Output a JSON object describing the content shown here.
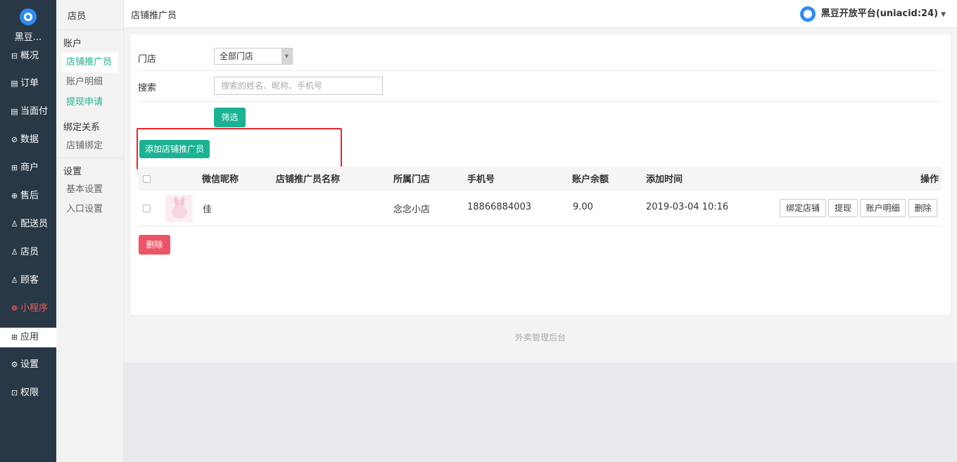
{
  "nav": {
    "brand": "黑豆...",
    "items": [
      {
        "label": "概况",
        "icon": "⊟"
      },
      {
        "label": "订单",
        "icon": "▤"
      },
      {
        "label": "当面付",
        "icon": "▤"
      },
      {
        "label": "数据",
        "icon": "⊘"
      },
      {
        "label": "商户",
        "icon": "⊞"
      },
      {
        "label": "售后",
        "icon": "⊕"
      },
      {
        "label": "配送员",
        "icon": "♙"
      },
      {
        "label": "店员",
        "icon": "♙"
      },
      {
        "label": "顾客",
        "icon": "♙"
      },
      {
        "label": "小程序",
        "icon": "❁"
      },
      {
        "label": "应用",
        "icon": "⊞"
      },
      {
        "label": "设置",
        "icon": "⚙"
      },
      {
        "label": "权限",
        "icon": "⊡"
      }
    ]
  },
  "subnav": {
    "title": "店员",
    "group_account": "账户",
    "link_promoter": "店铺推广员",
    "link_account_detail": "账户明细",
    "link_withdraw": "提现申请",
    "group_binding": "绑定关系",
    "link_store_binding": "店铺绑定",
    "group_settings": "设置",
    "link_basic_settings": "基本设置",
    "link_entry_settings": "入口设置"
  },
  "header": {
    "page_title": "店铺推广员",
    "account": "黑豆开放平台(uniacid:24)"
  },
  "filter": {
    "store_label": "门店",
    "store_value": "全部门店",
    "search_label": "搜索",
    "search_placeholder": "搜索的姓名、昵称、手机号",
    "search_value": "",
    "submit": "筛选"
  },
  "add_button": "添加店铺推广员",
  "table": {
    "headers": [
      "微信昵称",
      "店铺推广员名称",
      "所属门店",
      "手机号",
      "账户余额",
      "添加时间",
      "操作"
    ],
    "rows": [
      {
        "nickname": "佳",
        "name": "",
        "store": "念念小店",
        "phone": "18866884003",
        "balance": "9.00",
        "added": "2019-03-04 10:16",
        "actions": [
          "绑定店铺",
          "提现",
          "账户明细",
          "删除"
        ]
      }
    ]
  },
  "bulk_delete": "删除",
  "footer": "外卖管理后台",
  "colors": {
    "nav_bg": "#293846",
    "accent": "#1ab394",
    "danger": "#ed5565",
    "highlight": "#e8262a"
  }
}
